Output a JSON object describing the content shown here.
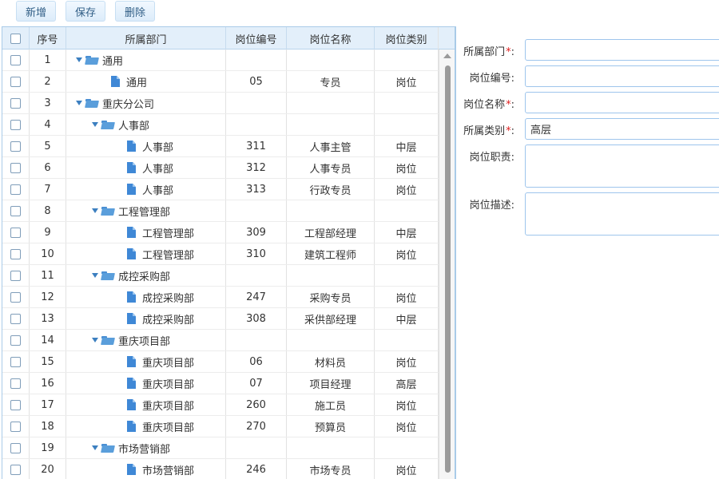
{
  "toolbar": {
    "add_label": "新增",
    "save_label": "保存",
    "delete_label": "删除"
  },
  "grid": {
    "columns": {
      "index": "序号",
      "dept": "所属部门",
      "code": "岗位编号",
      "name": "岗位名称",
      "type": "岗位类别"
    },
    "rows": [
      {
        "idx": "1",
        "dept": "通用",
        "level": 0,
        "kind": "folder",
        "code": "",
        "name": "",
        "type": ""
      },
      {
        "idx": "2",
        "dept": "通用",
        "level": 1,
        "kind": "file",
        "code": "05",
        "name": "专员",
        "type": "岗位"
      },
      {
        "idx": "3",
        "dept": "重庆分公司",
        "level": 0,
        "kind": "folder",
        "code": "",
        "name": "",
        "type": ""
      },
      {
        "idx": "4",
        "dept": "人事部",
        "level": 1,
        "kind": "folder",
        "code": "",
        "name": "",
        "type": ""
      },
      {
        "idx": "5",
        "dept": "人事部",
        "level": 2,
        "kind": "file",
        "code": "311",
        "name": "人事主管",
        "type": "中层"
      },
      {
        "idx": "6",
        "dept": "人事部",
        "level": 2,
        "kind": "file",
        "code": "312",
        "name": "人事专员",
        "type": "岗位"
      },
      {
        "idx": "7",
        "dept": "人事部",
        "level": 2,
        "kind": "file",
        "code": "313",
        "name": "行政专员",
        "type": "岗位"
      },
      {
        "idx": "8",
        "dept": "工程管理部",
        "level": 1,
        "kind": "folder",
        "code": "",
        "name": "",
        "type": ""
      },
      {
        "idx": "9",
        "dept": "工程管理部",
        "level": 2,
        "kind": "file",
        "code": "309",
        "name": "工程部经理",
        "type": "中层"
      },
      {
        "idx": "10",
        "dept": "工程管理部",
        "level": 2,
        "kind": "file",
        "code": "310",
        "name": "建筑工程师",
        "type": "岗位"
      },
      {
        "idx": "11",
        "dept": "成控采购部",
        "level": 1,
        "kind": "folder",
        "code": "",
        "name": "",
        "type": ""
      },
      {
        "idx": "12",
        "dept": "成控采购部",
        "level": 2,
        "kind": "file",
        "code": "247",
        "name": "采购专员",
        "type": "岗位"
      },
      {
        "idx": "13",
        "dept": "成控采购部",
        "level": 2,
        "kind": "file",
        "code": "308",
        "name": "采供部经理",
        "type": "中层"
      },
      {
        "idx": "14",
        "dept": "重庆项目部",
        "level": 1,
        "kind": "folder",
        "code": "",
        "name": "",
        "type": ""
      },
      {
        "idx": "15",
        "dept": "重庆项目部",
        "level": 2,
        "kind": "file",
        "code": "06",
        "name": "材料员",
        "type": "岗位"
      },
      {
        "idx": "16",
        "dept": "重庆项目部",
        "level": 2,
        "kind": "file",
        "code": "07",
        "name": "项目经理",
        "type": "高层"
      },
      {
        "idx": "17",
        "dept": "重庆项目部",
        "level": 2,
        "kind": "file",
        "code": "260",
        "name": "施工员",
        "type": "岗位"
      },
      {
        "idx": "18",
        "dept": "重庆项目部",
        "level": 2,
        "kind": "file",
        "code": "270",
        "name": "预算员",
        "type": "岗位"
      },
      {
        "idx": "19",
        "dept": "市场营销部",
        "level": 1,
        "kind": "folder",
        "code": "",
        "name": "",
        "type": ""
      },
      {
        "idx": "20",
        "dept": "市场营销部",
        "level": 2,
        "kind": "file",
        "code": "246",
        "name": "市场专员",
        "type": "岗位"
      }
    ]
  },
  "form": {
    "dept_label": "所属部门",
    "code_label": "岗位编号:",
    "name_label": "岗位名称",
    "type_label": "所属类别",
    "duty_label": "岗位职责:",
    "desc_label": "岗位描述:",
    "required_mark": "*",
    "colon": ":",
    "dept_value": "",
    "code_value": "",
    "name_value": "",
    "type_value": "高层",
    "duty_value": "",
    "desc_value": ""
  }
}
